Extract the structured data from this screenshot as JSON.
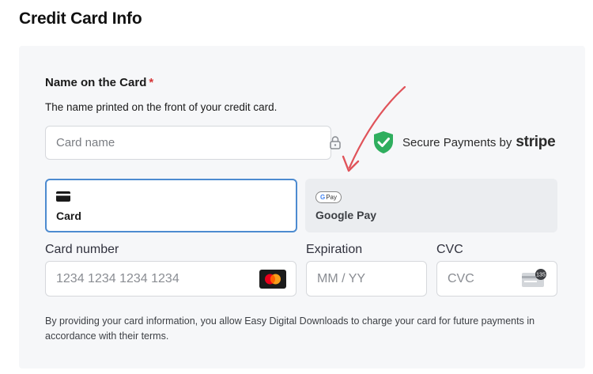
{
  "page": {
    "title": "Credit Card Info"
  },
  "name_field": {
    "label": "Name on the Card",
    "required_mark": "*",
    "description": "The name printed on the front of your credit card.",
    "placeholder": "Card name"
  },
  "secure_badge": {
    "text": "Secure Payments by",
    "brand": "stripe",
    "shield_color": "#2fae5e"
  },
  "payment_tabs": [
    {
      "label": "Card",
      "icon": "credit-card-icon",
      "selected": true
    },
    {
      "label": "Google Pay",
      "icon": "google-pay-icon",
      "badge_text": "Pay",
      "badge_letter": "G",
      "selected": false
    }
  ],
  "card_number": {
    "label": "Card number",
    "placeholder": "1234 1234 1234 1234",
    "icon": "mastercard-icon"
  },
  "expiration": {
    "label": "Expiration",
    "placeholder": "MM / YY"
  },
  "cvc": {
    "label": "CVC",
    "placeholder": "CVC",
    "icon": "cvc-card-icon",
    "icon_number": "135"
  },
  "terms_text": "By providing your card information, you allow Easy Digital Downloads to charge your card for future payments in accordance with their terms.",
  "colors": {
    "accent": "#4d8bd0",
    "required": "#d63638",
    "annotation_arrow": "#e0535a"
  }
}
